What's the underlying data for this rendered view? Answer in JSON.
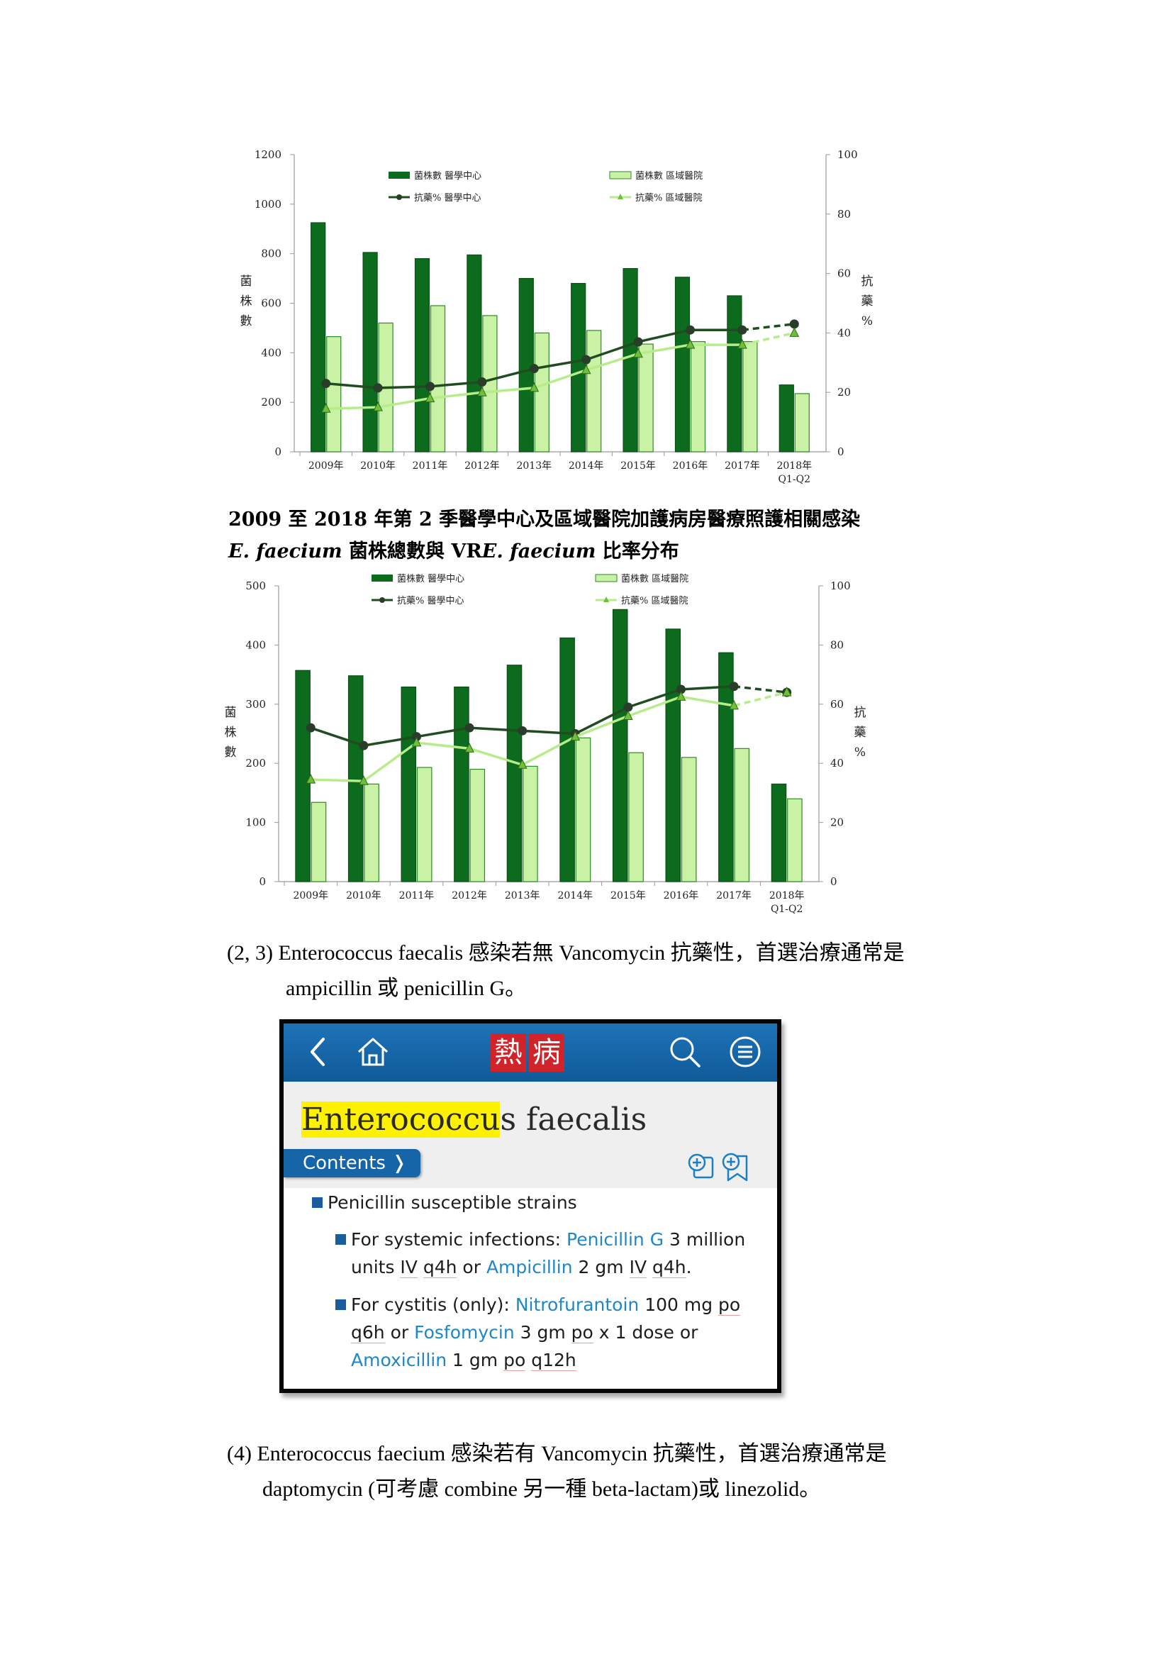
{
  "charts": [
    {
      "chart_data": {
        "type": "bar",
        "categories": [
          "2009年",
          "2010年",
          "2011年",
          "2012年",
          "2013年",
          "2014年",
          "2015年",
          "2016年",
          "2017年",
          "2018年\nQ1-Q2"
        ],
        "series": [
          {
            "name": "菌株數 醫學中心",
            "kind": "bar",
            "axis": "left",
            "values": [
              925,
              805,
              780,
              795,
              700,
              680,
              740,
              705,
              630,
              270
            ]
          },
          {
            "name": "菌株數 區域醫院",
            "kind": "bar",
            "axis": "left",
            "values": [
              465,
              520,
              590,
              550,
              480,
              490,
              435,
              445,
              445,
              235
            ]
          },
          {
            "name": "抗藥% 醫學中心",
            "kind": "line",
            "axis": "right",
            "values": [
              23,
              21.5,
              22,
              23.5,
              28,
              31,
              37,
              41,
              41,
              43
            ],
            "dashed_last": true
          },
          {
            "name": "抗藥% 區域醫院",
            "kind": "line",
            "axis": "right",
            "values": [
              14.5,
              15,
              18,
              20,
              21.5,
              27.5,
              33,
              36,
              36,
              40
            ],
            "dashed_last": true
          }
        ],
        "ylabel": "菌株數",
        "y2label": "抗藥%",
        "ylim": [
          0,
          1200
        ],
        "yticks": [
          0,
          200,
          400,
          600,
          800,
          1000,
          1200
        ],
        "y2lim": [
          0,
          100
        ],
        "y2ticks": [
          0,
          20,
          40,
          60,
          80,
          100
        ],
        "legend_position": "top"
      }
    },
    {
      "chart_data": {
        "type": "bar",
        "categories": [
          "2009年",
          "2010年",
          "2011年",
          "2012年",
          "2013年",
          "2014年",
          "2015年",
          "2016年",
          "2017年",
          "2018年\nQ1-Q2"
        ],
        "series": [
          {
            "name": "菌株數 醫學中心",
            "kind": "bar",
            "axis": "left",
            "values": [
              357,
              348,
              329,
              329,
              366,
              412,
              460,
              427,
              387,
              165
            ]
          },
          {
            "name": "菌株數 區域醫院",
            "kind": "bar",
            "axis": "left",
            "values": [
              134,
              165,
              193,
              190,
              195,
              243,
              218,
              210,
              225,
              140
            ]
          },
          {
            "name": "抗藥% 醫學中心",
            "kind": "line",
            "axis": "right",
            "values": [
              52,
              46,
              49,
              52,
              51,
              50,
              59,
              65,
              66,
              64
            ],
            "dashed_last": true
          },
          {
            "name": "抗藥% 區域醫院",
            "kind": "line",
            "axis": "right",
            "values": [
              34.5,
              34,
              47,
              45,
              39.5,
              49,
              56,
              62.5,
              59.5,
              64
            ],
            "dashed_last": true
          }
        ],
        "ylabel": "菌株數",
        "y2label": "抗藥%",
        "ylim": [
          0,
          500
        ],
        "yticks": [
          0,
          100,
          200,
          300,
          400,
          500
        ],
        "y2lim": [
          0,
          100
        ],
        "y2ticks": [
          0,
          20,
          40,
          60,
          80,
          100
        ],
        "legend_position": "top"
      }
    }
  ],
  "caption": {
    "line1": "2009 至 2018 年第 2 季醫學中心及區域醫院加護病房醫療照護相關感染",
    "line2_italic1": "E. faecium",
    "line2_mid": " 菌株總數與 VR",
    "line2_italic2": "E. faecium",
    "line2_end": " 比率分布"
  },
  "para1": {
    "line1": "(2, 3) Enterococcus faecalis 感染若無 Vancomycin 抗藥性，首選治療通常是",
    "line2": "ampicillin 或 penicillin G。"
  },
  "app": {
    "logo_char1": "熱",
    "logo_char2": "病",
    "title_highlight": "Enterococcu",
    "title_rest": "s faecalis",
    "contents_label": "Contents ❭",
    "section_heading": "Penicillin susceptible strains",
    "item1": {
      "prefix": "For systemic infections: ",
      "drug1": "Penicillin G",
      "after1": " 3 million",
      "line2_a": "units ",
      "line2_iv": "IV",
      "line2_sp": " ",
      "line2_q4h": "q4h",
      "line2_or": " or ",
      "drug2": "Ampicillin",
      "line2_dose": " 2 gm ",
      "line2_iv2": "IV",
      "line2_q4h2": "q4h",
      "line2_end": "."
    },
    "item2": {
      "prefix": "For cystitis (only): ",
      "drug1": "Nitrofurantoin",
      "after1": " 100 mg ",
      "po1": "po",
      "line2_q6h": "q6h",
      "line2_or": " or ",
      "drug2": "Fosfomycin",
      "line2_dose": " 3 gm ",
      "po2": "po",
      "line2_end": " x 1 dose or",
      "drug3": "Amoxicillin",
      "line3_dose": " 1 gm ",
      "po3": "po",
      "q12h": "q12h"
    }
  },
  "para2": {
    "line1": "(4) Enterococcus faecium 感染若有 Vancomycin 抗藥性，首選治療通常是",
    "line2": "daptomycin (可考慮 combine 另一種 beta-lactam)或 linezolid。"
  },
  "colors": {
    "dark_bar": "#0d6b1e",
    "light_bar": "#c9f2a4",
    "light_bar_edge": "#2f8a2a",
    "dark_line": "#1f4d1f",
    "light_line": "#b7ec8a",
    "app_blue": "#1565a8",
    "drug_blue": "#1c87c9"
  }
}
